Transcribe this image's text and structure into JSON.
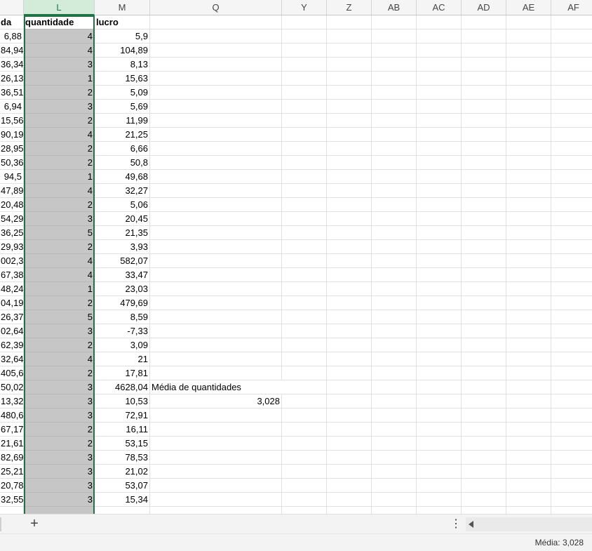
{
  "columns": [
    {
      "letter": "",
      "key": "K",
      "selected": false
    },
    {
      "letter": "L",
      "key": "L",
      "selected": true
    },
    {
      "letter": "M",
      "key": "M",
      "selected": false
    },
    {
      "letter": "Q",
      "key": "Q",
      "selected": false
    },
    {
      "letter": "Y",
      "key": "Y",
      "selected": false
    },
    {
      "letter": "Z",
      "key": "Z",
      "selected": false
    },
    {
      "letter": "AB",
      "key": "AB",
      "selected": false
    },
    {
      "letter": "AC",
      "key": "AC",
      "selected": false
    },
    {
      "letter": "AD",
      "key": "AD",
      "selected": false
    },
    {
      "letter": "AE",
      "key": "AE",
      "selected": false
    },
    {
      "letter": "AF",
      "key": "AF",
      "selected": false
    }
  ],
  "rows": [
    {
      "K": "da",
      "L": "quantidade",
      "M": "lucro",
      "header": true
    },
    {
      "K": "6,88",
      "L": "4",
      "M": "5,9"
    },
    {
      "K": "84,94",
      "L": "4",
      "M": "104,89"
    },
    {
      "K": "36,34",
      "L": "3",
      "M": "8,13"
    },
    {
      "K": "26,13",
      "L": "1",
      "M": "15,63"
    },
    {
      "K": "36,51",
      "L": "2",
      "M": "5,09"
    },
    {
      "K": "6,94",
      "L": "3",
      "M": "5,69"
    },
    {
      "K": "15,56",
      "L": "2",
      "M": "11,99"
    },
    {
      "K": "90,19",
      "L": "4",
      "M": "21,25"
    },
    {
      "K": "28,95",
      "L": "2",
      "M": "6,66"
    },
    {
      "K": "50,36",
      "L": "2",
      "M": "50,8"
    },
    {
      "K": "94,5",
      "L": "1",
      "M": "49,68"
    },
    {
      "K": "47,89",
      "L": "4",
      "M": "32,27"
    },
    {
      "K": "20,48",
      "L": "2",
      "M": "5,06"
    },
    {
      "K": "54,29",
      "L": "3",
      "M": "20,45"
    },
    {
      "K": "36,25",
      "L": "5",
      "M": "21,35"
    },
    {
      "K": "29,93",
      "L": "2",
      "M": "3,93"
    },
    {
      "K": "002,3",
      "L": "4",
      "M": "582,07"
    },
    {
      "K": "67,38",
      "L": "4",
      "M": "33,47"
    },
    {
      "K": "48,24",
      "L": "1",
      "M": "23,03"
    },
    {
      "K": "04,19",
      "L": "2",
      "M": "479,69"
    },
    {
      "K": "26,37",
      "L": "5",
      "M": "8,59"
    },
    {
      "K": "02,64",
      "L": "3",
      "M": "-7,33"
    },
    {
      "K": "62,39",
      "L": "2",
      "M": "3,09"
    },
    {
      "K": "32,64",
      "L": "4",
      "M": "21"
    },
    {
      "K": "405,6",
      "L": "2",
      "M": "17,81"
    },
    {
      "K": "50,02",
      "L": "3",
      "M": "4628,04",
      "Q": "Média de quantidades"
    },
    {
      "K": "13,32",
      "L": "3",
      "M": "10,53",
      "Q": "3,028"
    },
    {
      "K": "480,6",
      "L": "3",
      "M": "72,91"
    },
    {
      "K": "67,17",
      "L": "2",
      "M": "16,11"
    },
    {
      "K": "21,61",
      "L": "2",
      "M": "53,15"
    },
    {
      "K": "82,69",
      "L": "3",
      "M": "78,53"
    },
    {
      "K": "25,21",
      "L": "3",
      "M": "21,02"
    },
    {
      "K": "20,78",
      "L": "3",
      "M": "53,07"
    },
    {
      "K": "32,55",
      "L": "3",
      "M": "15,34"
    }
  ],
  "tabbar": {
    "add_label": "+",
    "more_label": "⋮"
  },
  "status": {
    "average": "Média: 3,028"
  }
}
